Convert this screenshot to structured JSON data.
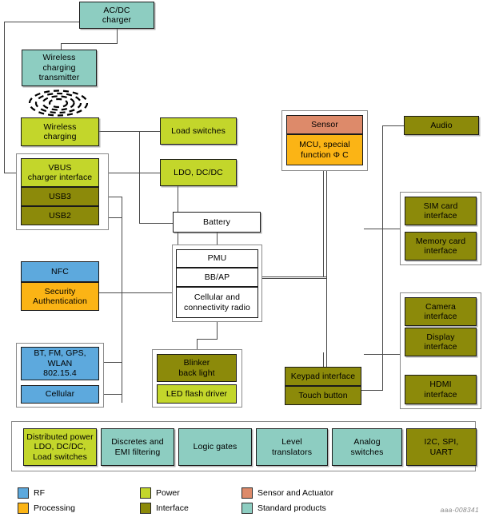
{
  "diagram": {
    "doc_id": "aaa-008341",
    "colors": {
      "rf": "#5DA9DD",
      "power": "#C3D62B",
      "interface": "#8C8A0A",
      "processing": "#FBB415",
      "sensor": "#DD8A6A",
      "standard": "#8DCDC1",
      "plain": "#FFFFFF"
    },
    "blocks": {
      "ac_dc_charger": "AC/DC\ncharger",
      "wireless_charging_transmitter": "Wireless\ncharging\ntransmitter",
      "wireless_charging": "Wireless\ncharging",
      "vbus_charger_interface": "VBUS\ncharger interface",
      "usb3": "USB3",
      "usb2": "USB2",
      "nfc": "NFC",
      "security_authentication": "Security\nAuthentication",
      "bt_fm_gps_wlan": "BT, FM, GPS,\nWLAN\n802.15.4",
      "cellular": "Cellular",
      "load_switches": "Load switches",
      "ldo_dcdc": "LDO, DC/DC",
      "battery": "Battery",
      "pmu": "PMU",
      "bb_ap": "BB/AP",
      "cellular_connectivity_radio": "Cellular and\nconnectivity radio",
      "blinker_back_light": "Blinker\nback light",
      "led_flash_driver": "LED flash driver",
      "sensor": "Sensor",
      "mcu_special_function": "MCU, special\nfunction Φ C",
      "keypad_interface": "Keypad interface",
      "touch_button": "Touch button",
      "audio": "Audio",
      "sim_card_interface": "SIM card\ninterface",
      "memory_card_interface": "Memory card\ninterface",
      "camera_interface": "Camera\ninterface",
      "display_interface": "Display\ninterface",
      "hdmi_interface": "HDMI\ninterface"
    },
    "bottom_bar": [
      {
        "label": "Distributed power\nLDO, DC/DC,\nLoad switches",
        "category": "power"
      },
      {
        "label": "Discretes and\nEMI filtering",
        "category": "standard"
      },
      {
        "label": "Logic gates",
        "category": "standard"
      },
      {
        "label": "Level\ntranslators",
        "category": "standard"
      },
      {
        "label": "Analog\nswitches",
        "category": "standard"
      },
      {
        "label": "I2C, SPI,\nUART",
        "category": "interface"
      }
    ],
    "legend": [
      {
        "label": "RF",
        "color": "#5DA9DD"
      },
      {
        "label": "Power",
        "color": "#C3D62B"
      },
      {
        "label": "Sensor and Actuator",
        "color": "#DD8A6A"
      },
      {
        "label": "Processing",
        "color": "#FBB415"
      },
      {
        "label": "Interface",
        "color": "#8C8A0A"
      },
      {
        "label": "Standard products",
        "color": "#8DCDC1"
      }
    ]
  }
}
